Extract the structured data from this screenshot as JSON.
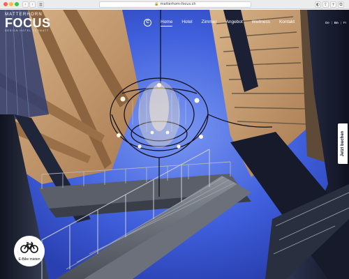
{
  "browser": {
    "url": "matterhorn-focus.ch",
    "back_glyph": "‹",
    "forward_glyph": "›"
  },
  "logo": {
    "top": "MATTERHORN",
    "main": "FOCUS",
    "sub": "DESIGN HOTEL ZERMATT"
  },
  "emblem": "C",
  "nav": {
    "items": [
      {
        "label": "Home",
        "active": true
      },
      {
        "label": "Hotel",
        "active": false
      },
      {
        "label": "Zimmer",
        "active": false
      },
      {
        "label": "Angebot",
        "active": false
      },
      {
        "label": "Wellness",
        "active": false
      },
      {
        "label": "Kontakt",
        "active": false
      }
    ]
  },
  "languages": [
    {
      "code": "De",
      "active": false
    },
    {
      "code": "En",
      "active": true
    },
    {
      "code": "Fr",
      "active": false
    }
  ],
  "side_tab": {
    "label": "Jetzt buchen"
  },
  "ebike": {
    "label": "E-Bike mieten",
    "icon": "bicycle-icon"
  },
  "colors": {
    "sky": "#3a5bd8",
    "sky_light": "#6f8ff0",
    "steel_dark": "#1d2030",
    "wood": "#c79a6c",
    "white": "#ffffff"
  }
}
